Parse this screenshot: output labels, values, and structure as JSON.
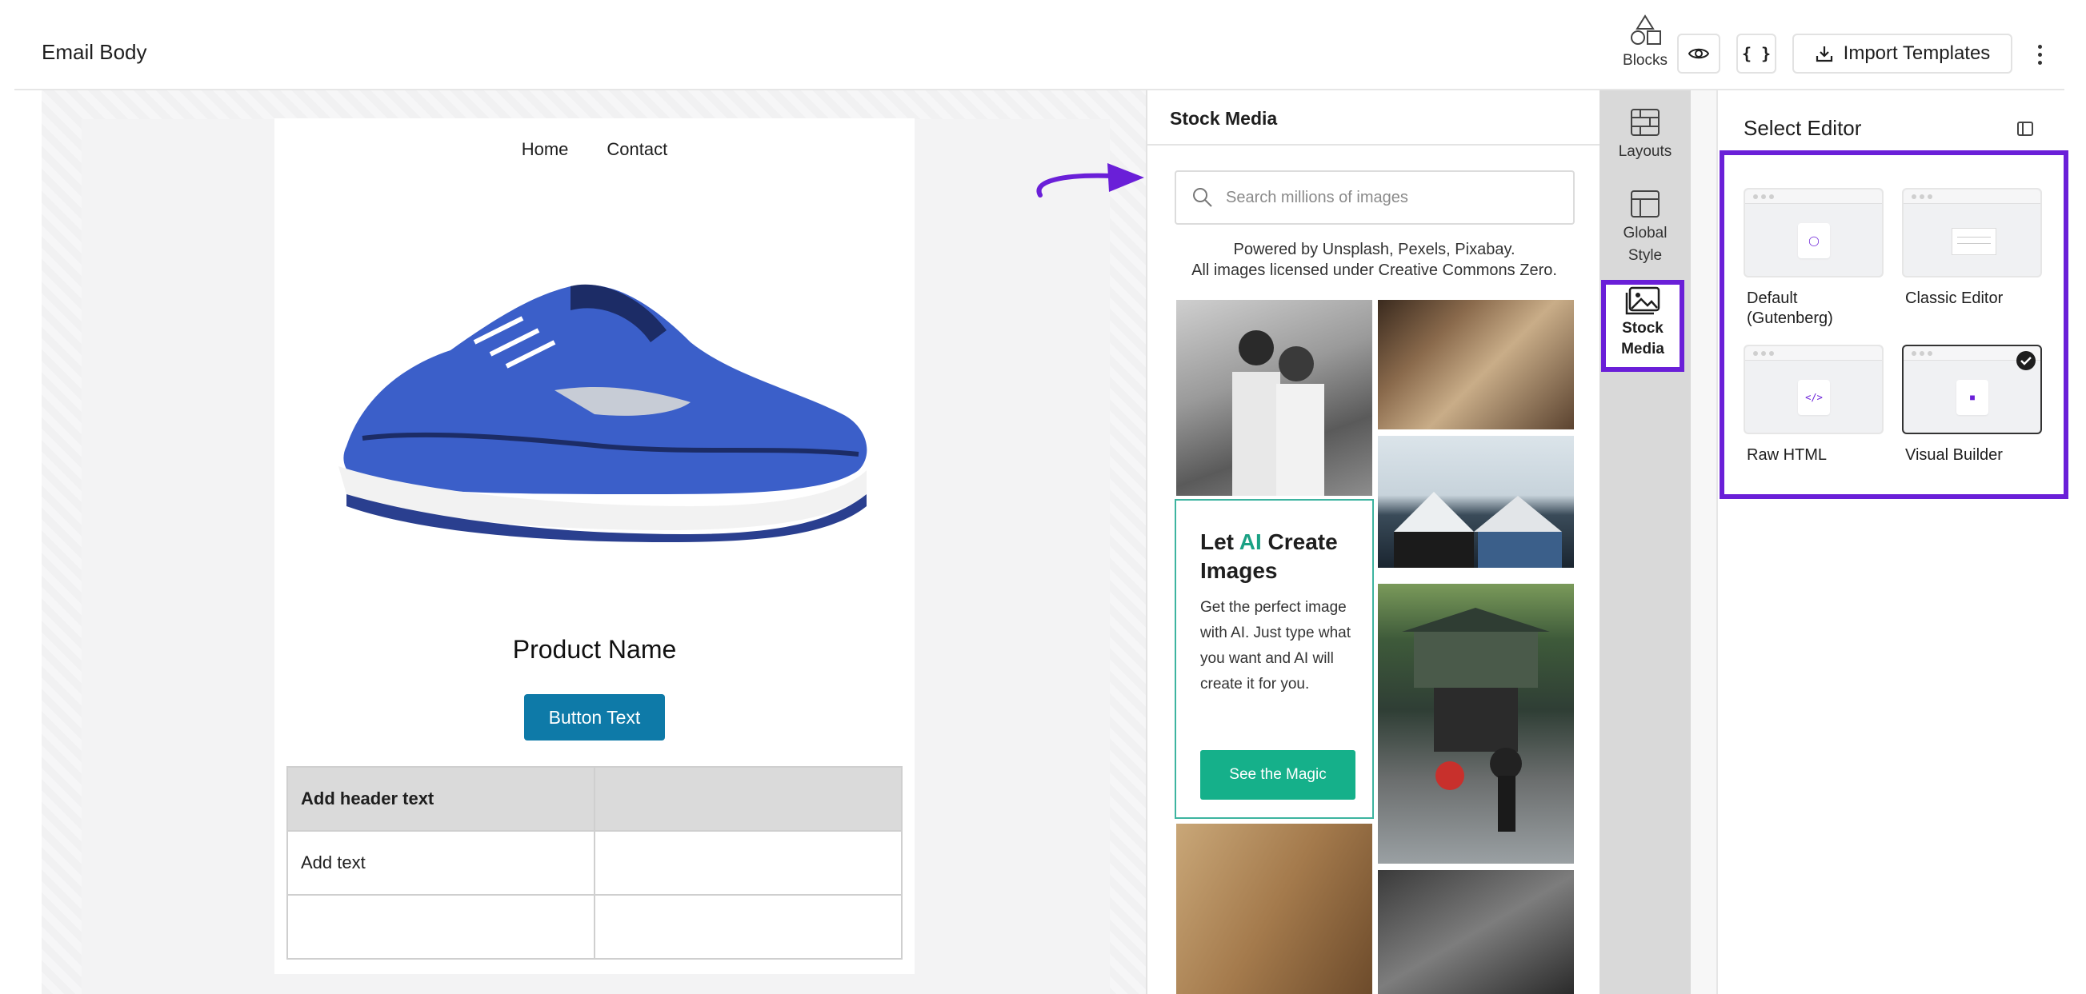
{
  "header": {
    "title": "Email Body",
    "import_label": "Import Templates",
    "code_label": "{ }"
  },
  "email": {
    "nav": [
      "Home",
      "Contact"
    ],
    "product_name": "Product Name",
    "button_text": "Button Text",
    "table": {
      "rows": [
        [
          "Add header text",
          ""
        ],
        [
          "Add text",
          ""
        ],
        [
          "",
          ""
        ]
      ]
    }
  },
  "stock_media": {
    "title": "Stock Media",
    "search_placeholder": "Search millions of images",
    "credit_line1": "Powered by Unsplash, Pexels, Pixabay.",
    "credit_line2": "All images licensed under Creative Commons Zero.",
    "promo": {
      "title_pre": "Let ",
      "title_ai": "AI",
      "title_post": " Create Images",
      "text": "Get the perfect image with AI. Just type what you want and AI will create it for you.",
      "button": "See the Magic"
    }
  },
  "tabs": [
    {
      "label": "Blocks",
      "icon": "blocks-icon"
    },
    {
      "label": "Layouts",
      "icon": "layouts-icon"
    },
    {
      "label": "Global Style",
      "icon": "global-style-icon"
    },
    {
      "label": "Stock Media",
      "icon": "image-icon",
      "active": true
    }
  ],
  "editor": {
    "title": "Select Editor",
    "options": [
      {
        "label": "Default (Gutenberg)",
        "selected": false
      },
      {
        "label": "Classic Editor",
        "selected": false
      },
      {
        "label": "Raw HTML",
        "selected": false
      },
      {
        "label": "Visual Builder",
        "selected": true
      }
    ]
  },
  "colors": {
    "accent": "#6a1fd8",
    "email_button": "#0e7aa8",
    "promo_button": "#15b08a",
    "promo_ai": "#1aa184"
  }
}
